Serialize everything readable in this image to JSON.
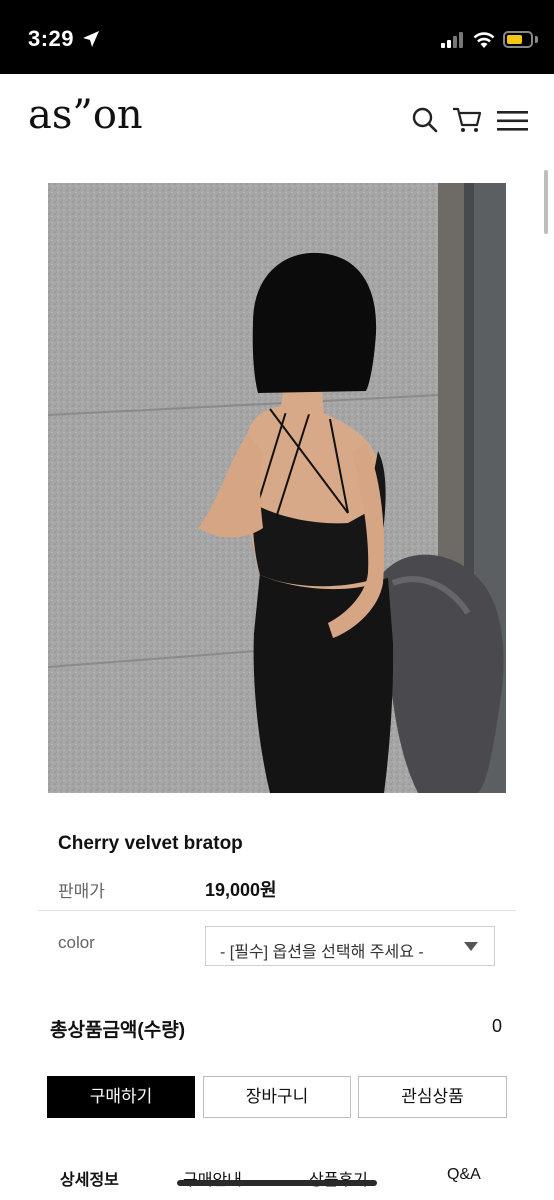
{
  "status_bar": {
    "time": "3:29",
    "battery_level": 0.7,
    "battery_color": "#f5c518"
  },
  "header": {
    "logo": "as”on",
    "icons": [
      "search-icon",
      "cart-icon",
      "menu-icon"
    ]
  },
  "product": {
    "image_icon": "product-photo",
    "name": "Cherry velvet bratop",
    "price_label": "판매가",
    "price": "19,000원",
    "color_label": "color",
    "color_select_value": "- [필수] 옵션을 선택해 주세요 -",
    "total_label": "총상품금액(수량)",
    "total_value": "0"
  },
  "actions": {
    "buy": "구매하기",
    "cart": "장바구니",
    "wishlist": "관심상품"
  },
  "tabs": [
    "상세정보",
    "구매안내",
    "상품후기",
    "Q&A"
  ],
  "colors": {
    "primary": "#000000",
    "border": "#bdbdbd"
  }
}
